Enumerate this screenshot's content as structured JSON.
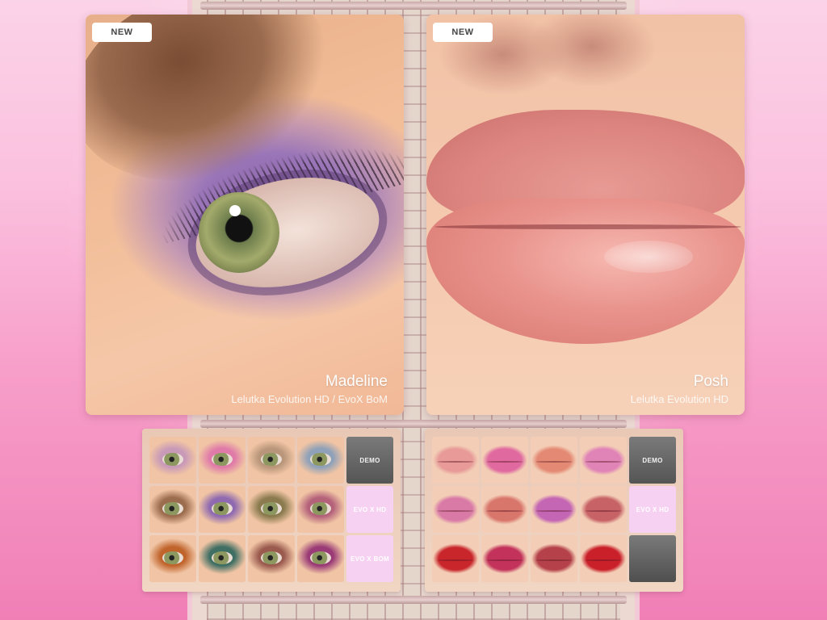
{
  "cards": [
    {
      "badge": "NEW",
      "name": "Madeline",
      "subtitle": "Lelutka Evolution HD / EvoX BoM"
    },
    {
      "badge": "NEW",
      "name": "Posh",
      "subtitle": "Lelutka Evolution HD"
    }
  ],
  "eye_panel": {
    "swatch_colors": [
      [
        "#c99ab8",
        "#e07aa8",
        "#b9967a",
        "#8fa1b8"
      ],
      [
        "#9b6c4e",
        "#8f6ab0",
        "#8a7a4e",
        "#b4617a"
      ],
      [
        "#c0642c",
        "#3f6e63",
        "#9a5a4e",
        "#9a3a76"
      ]
    ],
    "tiles": [
      "DEMO",
      "EVO X HD",
      "EVO X BOM"
    ]
  },
  "lip_panel": {
    "swatch_colors": [
      [
        "#e79a98",
        "#e06aa0",
        "#e48a74",
        "#e083b6"
      ],
      [
        "#d97aa6",
        "#d9766c",
        "#c466b4",
        "#c76266"
      ],
      [
        "#c9262c",
        "#c2325a",
        "#b5424a",
        "#c9202a"
      ]
    ],
    "tiles": [
      "DEMO",
      "EVO X HD",
      ""
    ]
  }
}
